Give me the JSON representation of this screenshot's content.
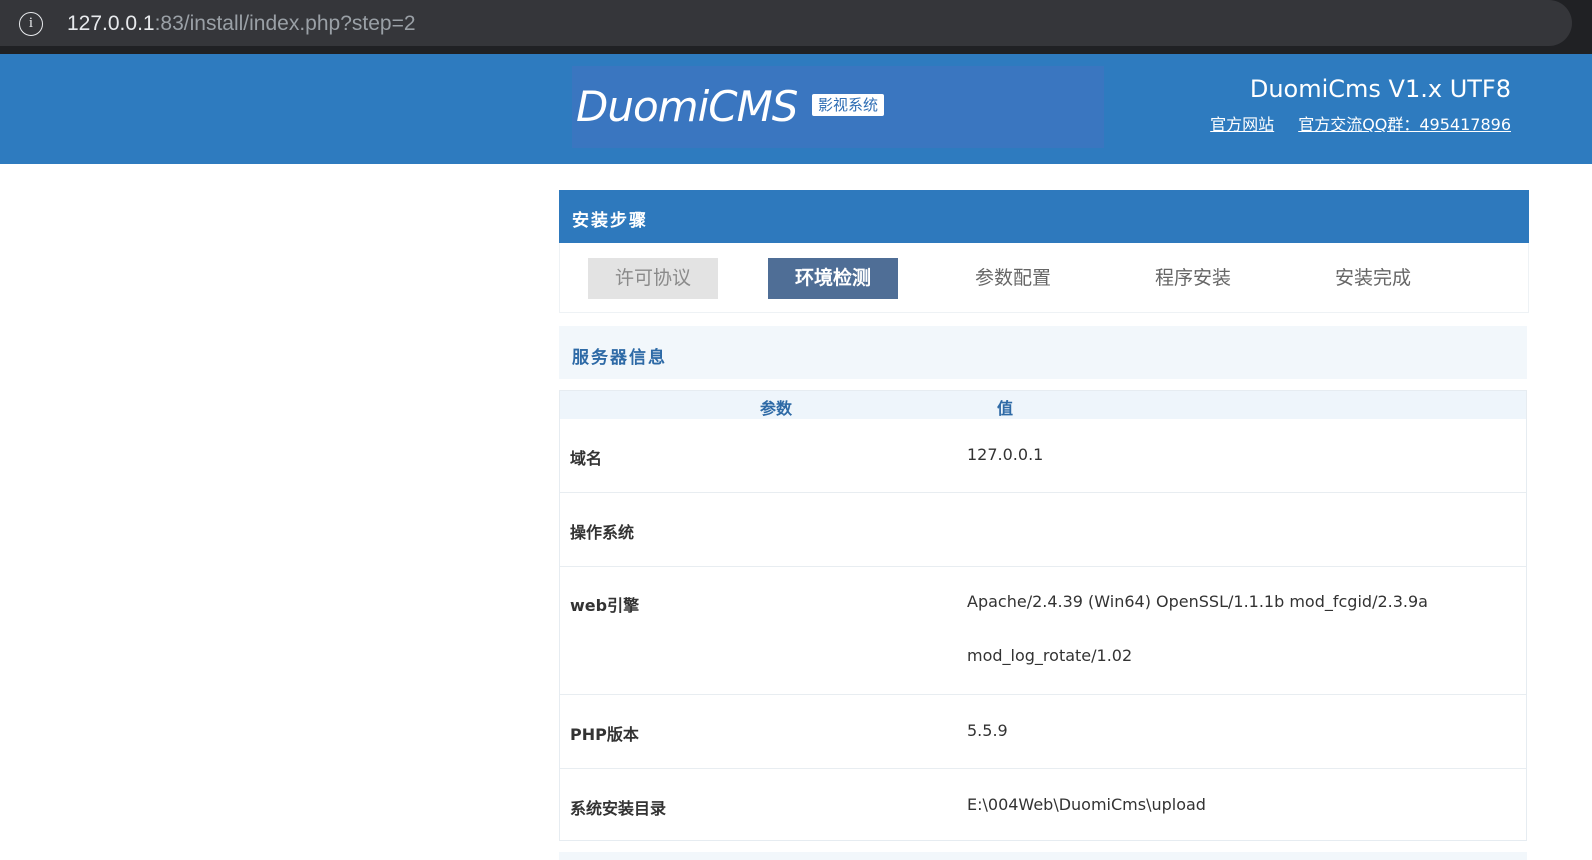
{
  "browser": {
    "url_host": "127.0.0.1",
    "url_rest": ":83/install/index.php?step=2"
  },
  "header": {
    "logo_text": "DuomiCMS",
    "logo_tag": "影视系统",
    "version": "DuomiCms V1.x UTF8",
    "links": [
      "官方网站",
      "官方交流QQ群：495417896"
    ]
  },
  "steps": {
    "title": "安装步骤",
    "items": [
      {
        "label": "许可协议",
        "state": "done"
      },
      {
        "label": "环境检测",
        "state": "active"
      },
      {
        "label": "参数配置",
        "state": "pending"
      },
      {
        "label": "程序安装",
        "state": "pending"
      },
      {
        "label": "安装完成",
        "state": "pending"
      }
    ]
  },
  "server_info": {
    "title": "服务器信息",
    "columns": [
      "参数",
      "值"
    ],
    "rows": [
      {
        "key": "域名",
        "value": "127.0.0.1",
        "value2": ""
      },
      {
        "key": "操作系统",
        "value": "",
        "value2": ""
      },
      {
        "key": "web引擎",
        "value": "Apache/2.4.39 (Win64) OpenSSL/1.1.1b mod_fcgid/2.3.9a",
        "value2": "mod_log_rotate/1.02"
      },
      {
        "key": "PHP版本",
        "value": "5.5.9",
        "value2": ""
      },
      {
        "key": "系统安装目录",
        "value": "E:\\004Web\\DuomiCms\\upload",
        "value2": ""
      }
    ]
  },
  "colors": {
    "header_bg": "#2e7bbf",
    "step_active": "#4f6e96",
    "step_done": "#e3e3e3"
  },
  "icons": {
    "site_info": "info-icon"
  }
}
